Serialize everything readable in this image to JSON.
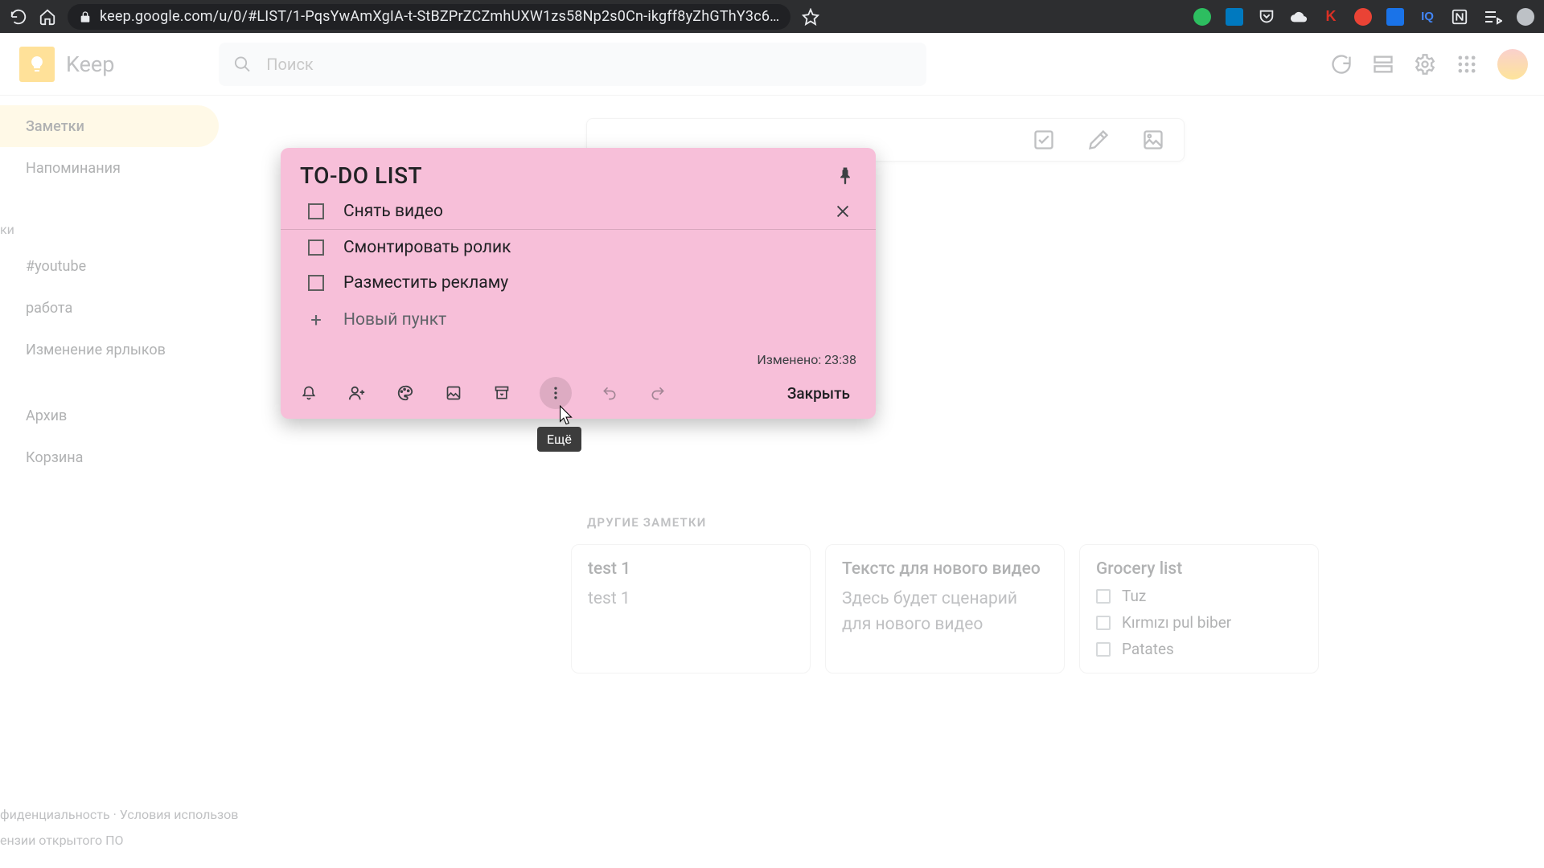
{
  "browser": {
    "url": "keep.google.com/u/0/#LIST/1-PqsYwAmXgIA-t-StBZPrZCZmhUXW1zs58Np2s0Cn-ikgff8yZhGThY3c6…"
  },
  "header": {
    "app_name": "Keep",
    "search_placeholder": "Поиск"
  },
  "sidebar": {
    "items": [
      {
        "label": "Заметки",
        "active": true
      },
      {
        "label": "Напоминания",
        "active": false
      }
    ],
    "label_section": "ки",
    "labels": [
      {
        "label": "#youtube"
      },
      {
        "label": "работа"
      },
      {
        "label": "Изменение ярлыков"
      }
    ],
    "bottom": [
      {
        "label": "Архив"
      },
      {
        "label": "Корзина"
      }
    ],
    "footer1": "фиденциальность  ·  Условия использов",
    "footer2": "ензии открытого ПО"
  },
  "section_other": "ДРУГИЕ ЗАМЕТКИ",
  "cards": [
    {
      "title": "test 1",
      "body": "test 1"
    },
    {
      "title": "Текстс для нового видео",
      "body": "Здесь будет сценарий для нового видео"
    },
    {
      "title": "Grocery list",
      "list": [
        "Tuz",
        "Kırmızı pul biber",
        "Patates"
      ]
    }
  ],
  "modal": {
    "title": "TO-DO LIST",
    "items": [
      "Снять видео",
      "Смонтировать ролик",
      "Разместить рекламу"
    ],
    "add_label": "Новый пункт",
    "modified": "Изменено: 23:38",
    "close": "Закрыть",
    "tooltip": "Ещё"
  }
}
